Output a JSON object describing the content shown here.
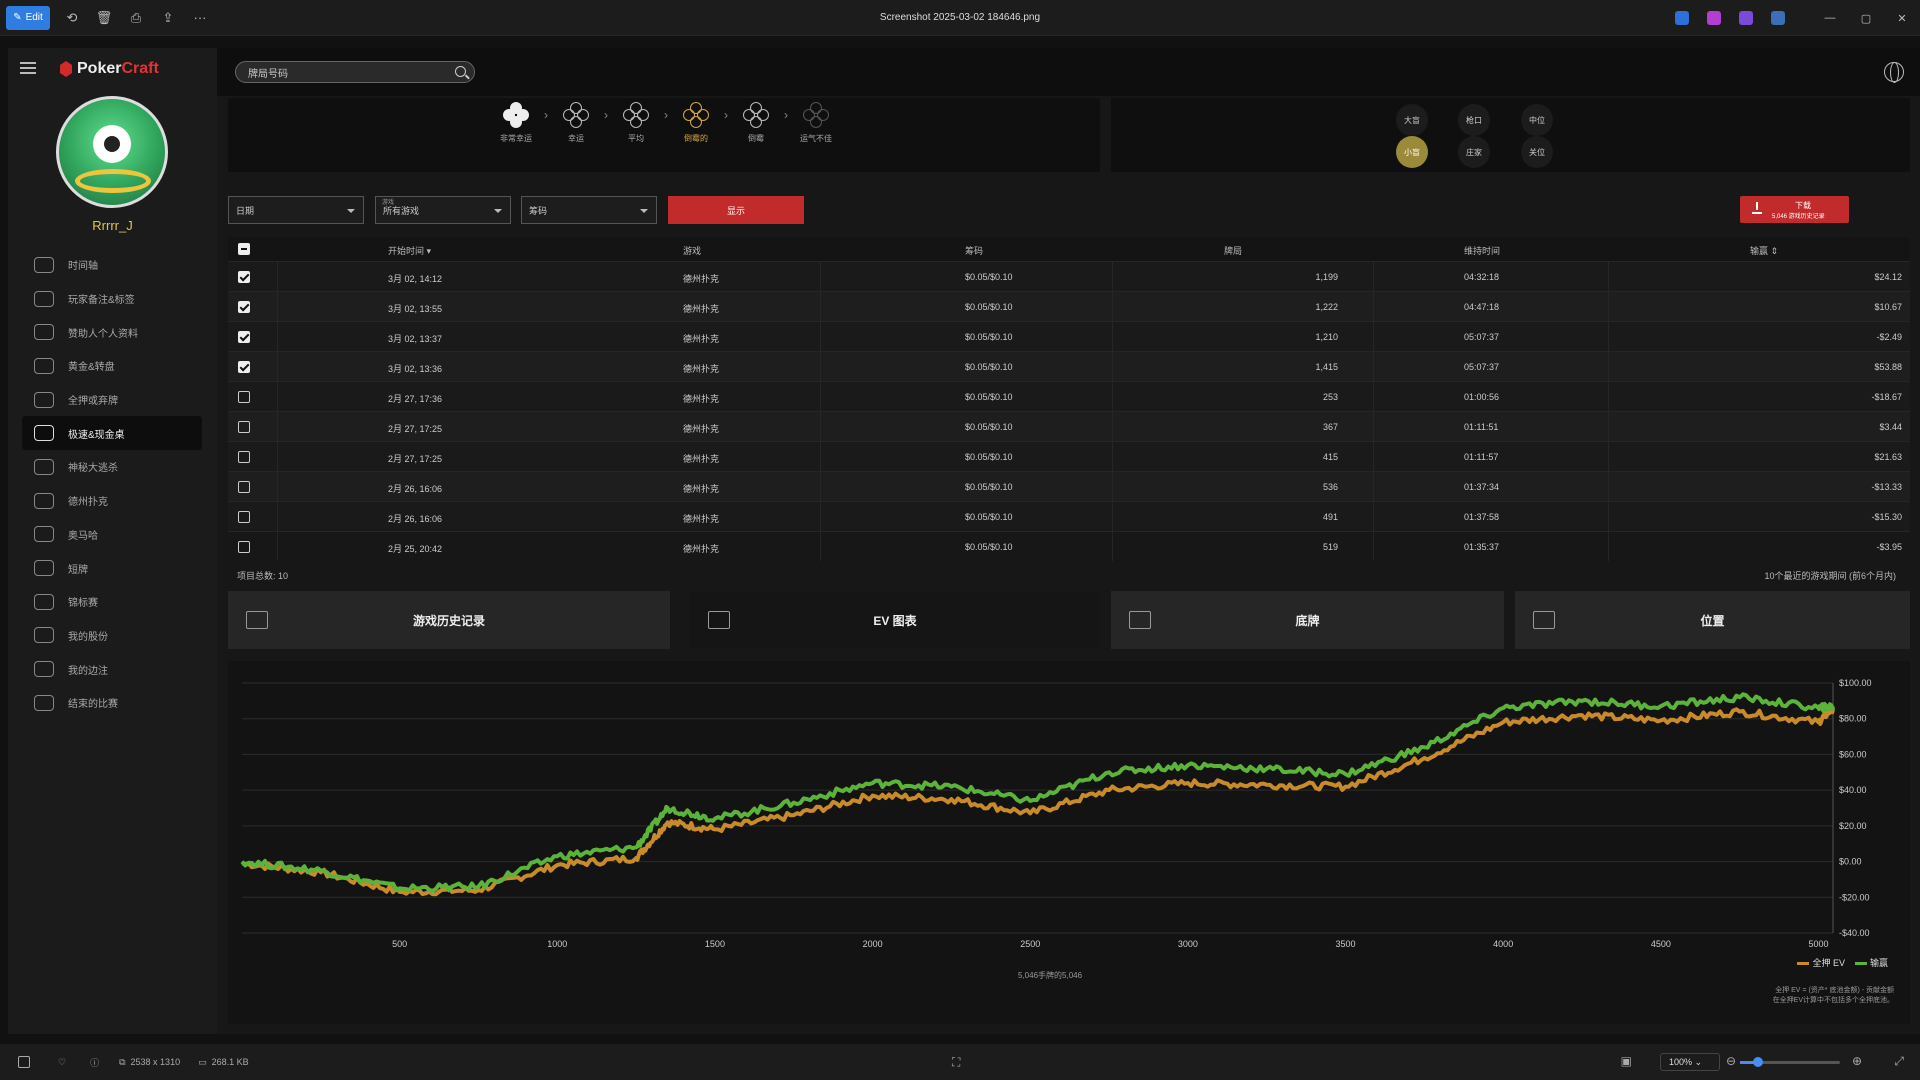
{
  "titlebar": {
    "edit_label": "Edit",
    "title": "Screenshot 2025-03-02 184646.png",
    "icons": [
      "rotate-icon",
      "delete-icon",
      "print-icon",
      "share-icon",
      "more-icon"
    ]
  },
  "sidebar": {
    "brand_a": "Poker",
    "brand_b": "Craft",
    "username": "Rrrrr_J",
    "items": [
      {
        "label": "时间轴"
      },
      {
        "label": "玩家备注&标签"
      },
      {
        "label": "赞助人个人资料"
      },
      {
        "label": "黄金&转盘"
      },
      {
        "label": "全押或弃牌"
      },
      {
        "label": "极速&现金桌"
      },
      {
        "label": "神秘大逃杀"
      },
      {
        "label": "德州扑克"
      },
      {
        "label": "奥马哈"
      },
      {
        "label": "短牌"
      },
      {
        "label": "锦标赛"
      },
      {
        "label": "我的股份"
      },
      {
        "label": "我的边注"
      },
      {
        "label": "结束的比赛"
      }
    ],
    "active_index": 5
  },
  "search": {
    "placeholder": "牌局号码",
    "value": "牌局号码"
  },
  "luck": {
    "steps": [
      {
        "label": "非常幸运"
      },
      {
        "label": "幸运"
      },
      {
        "label": "平均"
      },
      {
        "label": "倒霉的"
      },
      {
        "label": "倒霉"
      },
      {
        "label": "运气不佳"
      }
    ],
    "active_index": 3
  },
  "positions": {
    "row1": [
      "大盲",
      "枪口",
      "中位"
    ],
    "row2": [
      "小盲",
      "庄家",
      "关位"
    ],
    "active": "小盲"
  },
  "filters": {
    "date": "日期",
    "game_tiny": "游戏",
    "game": "所有游戏",
    "stakes": "筹码",
    "show_button": "显示",
    "download_l1": "下载",
    "download_l2": "5,046 游戏历史记录"
  },
  "table": {
    "headers": {
      "start": "开始时间",
      "game": "游戏",
      "stakes": "筹码",
      "hands": "牌局",
      "duration": "维持时间",
      "result": "输赢"
    },
    "rows": [
      {
        "checked": true,
        "start": "3月 02, 14:12",
        "game": "德州扑克",
        "stakes": "$0.05/$0.10",
        "hands": "1,199",
        "duration": "04:32:18",
        "result": "$24.12"
      },
      {
        "checked": true,
        "start": "3月 02, 13:55",
        "game": "德州扑克",
        "stakes": "$0.05/$0.10",
        "hands": "1,222",
        "duration": "04:47:18",
        "result": "$10.67"
      },
      {
        "checked": true,
        "start": "3月 02, 13:37",
        "game": "德州扑克",
        "stakes": "$0.05/$0.10",
        "hands": "1,210",
        "duration": "05:07:37",
        "result": "-$2.49"
      },
      {
        "checked": true,
        "start": "3月 02, 13:36",
        "game": "德州扑克",
        "stakes": "$0.05/$0.10",
        "hands": "1,415",
        "duration": "05:07:37",
        "result": "$53.88"
      },
      {
        "checked": false,
        "start": "2月 27, 17:36",
        "game": "德州扑克",
        "stakes": "$0.05/$0.10",
        "hands": "253",
        "duration": "01:00:56",
        "result": "-$18.67"
      },
      {
        "checked": false,
        "start": "2月 27, 17:25",
        "game": "德州扑克",
        "stakes": "$0.05/$0.10",
        "hands": "367",
        "duration": "01:11:51",
        "result": "$3.44"
      },
      {
        "checked": false,
        "start": "2月 27, 17:25",
        "game": "德州扑克",
        "stakes": "$0.05/$0.10",
        "hands": "415",
        "duration": "01:11:57",
        "result": "$21.63"
      },
      {
        "checked": false,
        "start": "2月 26, 16:06",
        "game": "德州扑克",
        "stakes": "$0.05/$0.10",
        "hands": "536",
        "duration": "01:37:34",
        "result": "-$13.33"
      },
      {
        "checked": false,
        "start": "2月 26, 16:06",
        "game": "德州扑克",
        "stakes": "$0.05/$0.10",
        "hands": "491",
        "duration": "01:37:58",
        "result": "-$15.30"
      },
      {
        "checked": false,
        "start": "2月 25, 20:42",
        "game": "德州扑克",
        "stakes": "$0.05/$0.10",
        "hands": "519",
        "duration": "01:35:37",
        "result": "-$3.95"
      }
    ],
    "footer_left": "项目总数: 10",
    "footer_right": "10个最近的游戏期间 (前6个月内)"
  },
  "tabs": [
    {
      "label": "游戏历史记录"
    },
    {
      "label": "EV 图表"
    },
    {
      "label": "底牌"
    },
    {
      "label": "位置"
    }
  ],
  "active_tab": 1,
  "chart_data": {
    "type": "line",
    "x": [
      0,
      250,
      500,
      750,
      1000,
      1250,
      1350,
      1500,
      1750,
      2000,
      2250,
      2500,
      2750,
      3000,
      3250,
      3500,
      3750,
      4000,
      4250,
      4500,
      4750,
      5000,
      5046
    ],
    "series": [
      {
        "name": "全押 EV",
        "color": "#c98b2a",
        "values": [
          -1,
          -6,
          -17,
          -16,
          -2,
          2,
          22,
          18,
          26,
          37,
          35,
          27,
          40,
          44,
          43,
          42,
          58,
          78,
          82,
          79,
          84,
          78,
          86
        ]
      },
      {
        "name": "输赢",
        "color": "#5cb33a",
        "values": [
          0,
          -5,
          -15,
          -14,
          3,
          8,
          30,
          24,
          33,
          44,
          42,
          34,
          50,
          54,
          52,
          49,
          64,
          86,
          90,
          87,
          92,
          86,
          87
        ]
      }
    ],
    "xticks": [
      500,
      1000,
      1500,
      2000,
      2500,
      3000,
      3500,
      4000,
      4500,
      5000
    ],
    "yticks": [
      "$100.00",
      "$80.00",
      "$60.00",
      "$40.00",
      "$20.00",
      "$0.00",
      "-$20.00",
      "-$40.00"
    ],
    "ylim": [
      -40,
      100
    ],
    "xlim": [
      0,
      5046
    ],
    "hand_count_label": "5,046手牌的5,046",
    "note_line1": "全押 EV = (资产* 底池金额) - 贡献金额",
    "note_line2": "在全押EV计算中不包括多个全押底池。",
    "grid": true,
    "legend_position": "bottom-right"
  },
  "statusbar": {
    "dimensions": "2538 x 1310",
    "filesize": "268.1 KB",
    "zoom": "100%",
    "zoom_level": 0.18
  }
}
